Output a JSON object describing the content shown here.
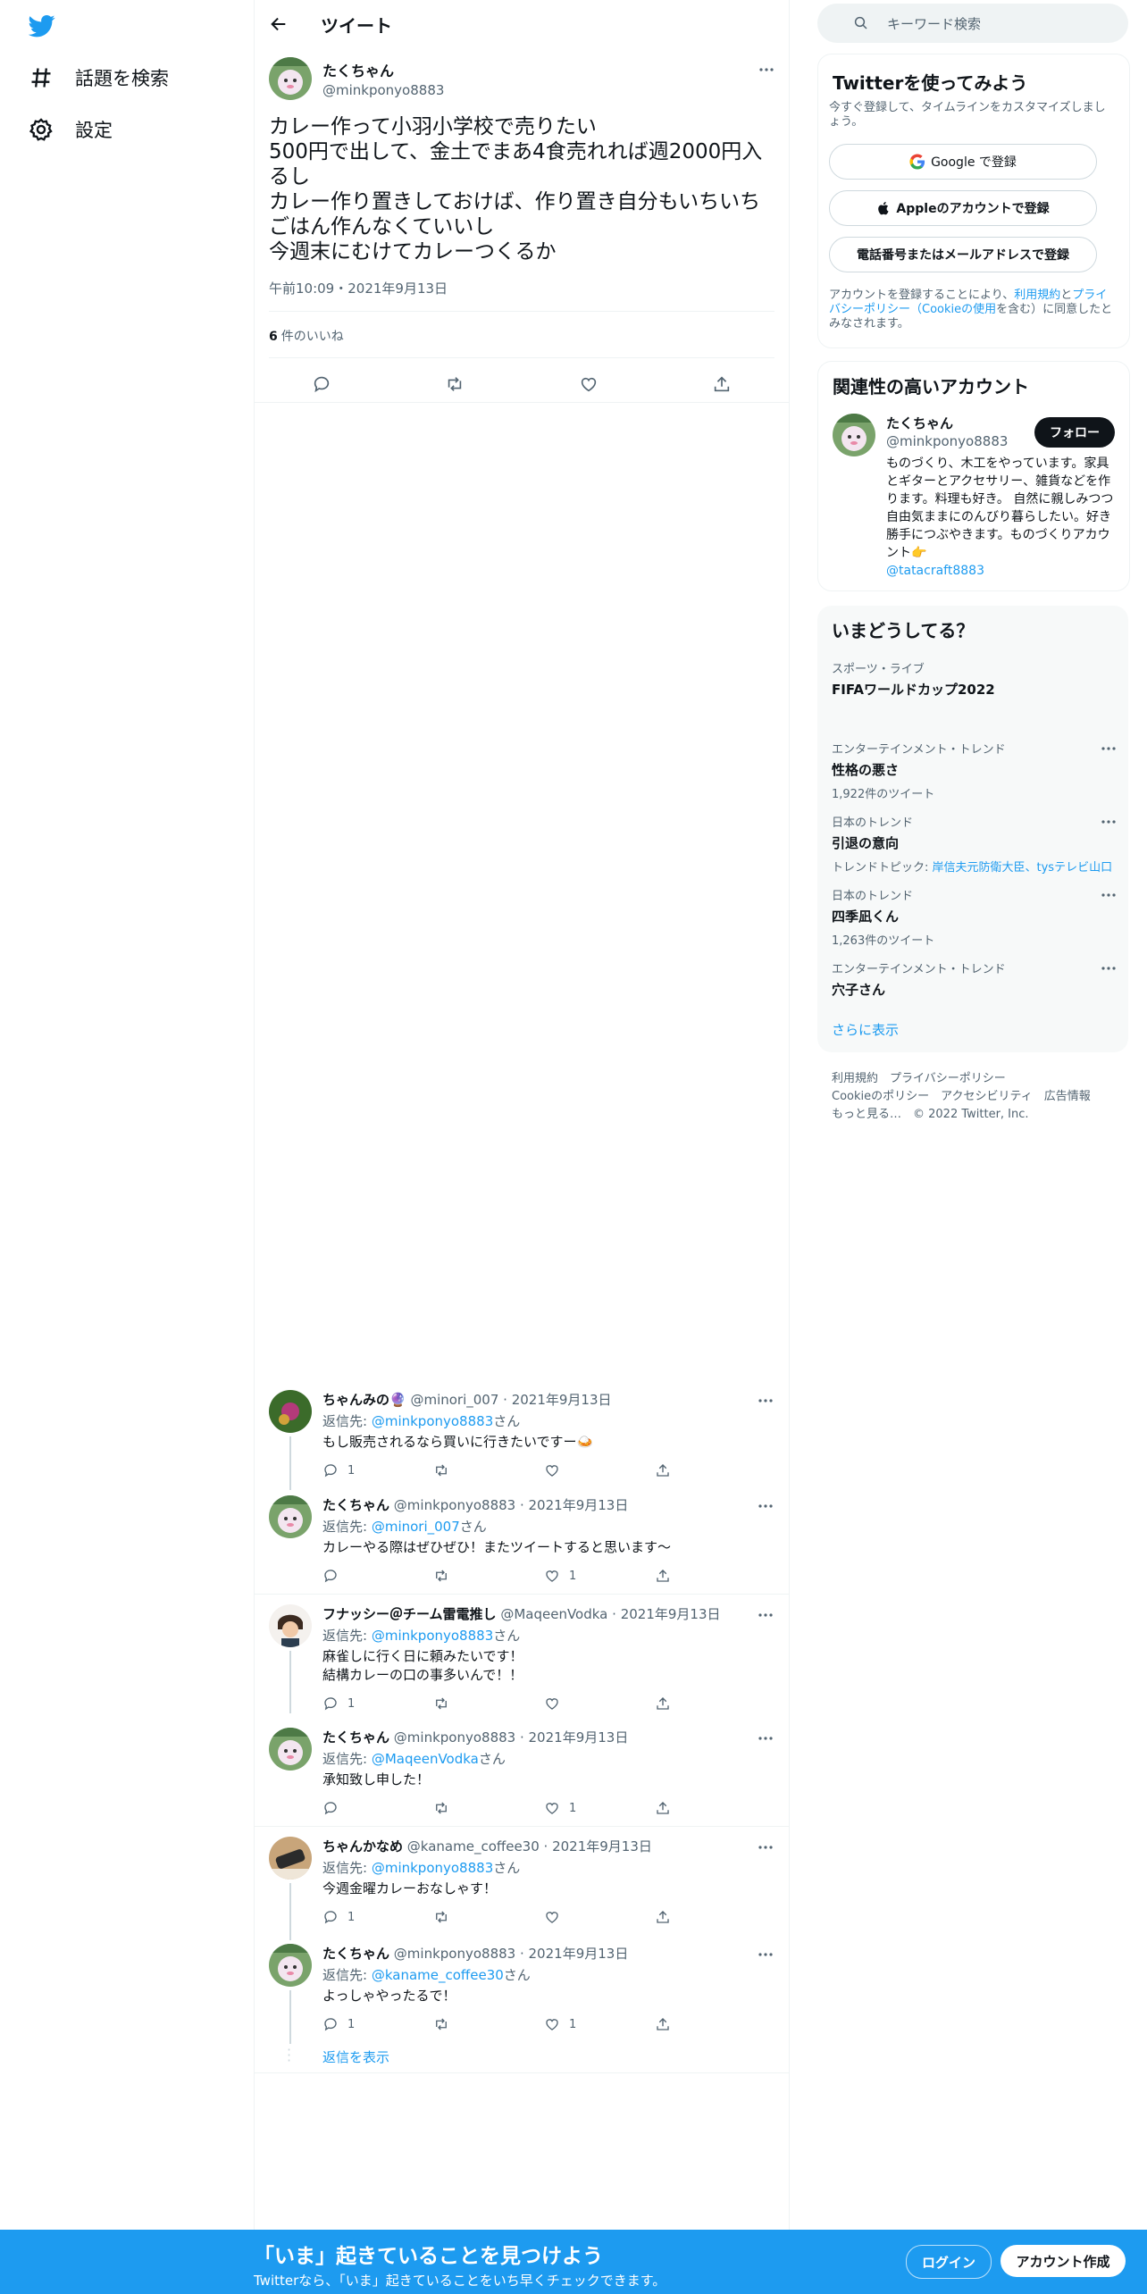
{
  "nav": {
    "explore": "話題を検索",
    "settings": "設定"
  },
  "header": {
    "title": "ツイート"
  },
  "main_tweet": {
    "name": "たくちゃん",
    "handle": "@minkponyo8883",
    "text": "カレー作って小羽小学校で売りたい\n500円で出して、金土でまあ4食売れれば週2000円入るし\nカレー作り置きしておけば、作り置き自分もいちいちごはん作んなくていいし\n今週末にむけてカレーつくるか",
    "time": "午前10:09・2021年9月13日",
    "likes_count": "6",
    "likes_label": "件のいいね"
  },
  "replies": [
    {
      "name": "ちゃんみの🔮",
      "handle": "@minori_007",
      "date": "2021年9月13日",
      "to_label": "返信先: ",
      "to_handle": "@minkponyo8883",
      "to_suffix": "さん",
      "text": "もし販売されるなら買いに行きたいですー🍛",
      "reply_count": "1",
      "retweet_count": "",
      "like_count": ""
    },
    {
      "name": "たくちゃん",
      "handle": "@minkponyo8883",
      "date": "2021年9月13日",
      "to_label": "返信先: ",
      "to_handle": "@minori_007",
      "to_suffix": "さん",
      "text": "カレーやる際はぜひぜひ！またツイートすると思います〜",
      "reply_count": "",
      "retweet_count": "",
      "like_count": "1"
    },
    {
      "name": "フナッシー＠チーム雷電推し",
      "handle": "@MaqeenVodka",
      "date": "2021年9月13日",
      "to_label": "返信先: ",
      "to_handle": "@minkponyo8883",
      "to_suffix": "さん",
      "text": "麻雀しに行く日に頼みたいです！\n結構カレーの口の事多いんで！！",
      "reply_count": "1",
      "retweet_count": "",
      "like_count": ""
    },
    {
      "name": "たくちゃん",
      "handle": "@minkponyo8883",
      "date": "2021年9月13日",
      "to_label": "返信先: ",
      "to_handle": "@MaqeenVodka",
      "to_suffix": "さん",
      "text": "承知致し申した！",
      "reply_count": "",
      "retweet_count": "",
      "like_count": "1"
    },
    {
      "name": "ちゃんかなめ",
      "handle": "@kaname_coffee30",
      "date": "2021年9月13日",
      "to_label": "返信先: ",
      "to_handle": "@minkponyo8883",
      "to_suffix": "さん",
      "text": "今週金曜カレーおなしゃす！",
      "reply_count": "1",
      "retweet_count": "",
      "like_count": ""
    },
    {
      "name": "たくちゃん",
      "handle": "@minkponyo8883",
      "date": "2021年9月13日",
      "to_label": "返信先: ",
      "to_handle": "@kaname_coffee30",
      "to_suffix": "さん",
      "text": "よっしゃやったるで！",
      "reply_count": "1",
      "retweet_count": "",
      "like_count": "1"
    }
  ],
  "show_replies": "返信を表示",
  "search": {
    "placeholder": "キーワード検索"
  },
  "signup_card": {
    "title": "Twitterを使ってみよう",
    "subtitle": "今すぐ登録して、タイムラインをカスタマイズしましょう。",
    "google": "Google で登録",
    "apple": "Appleのアカウントで登録",
    "phone": "電話番号またはメールアドレスで登録",
    "legal_prefix": "アカウントを登録することにより、",
    "legal_terms": "利用規約",
    "legal_and": "と",
    "legal_privacy": "プライバシーポリシー（Cookieの使用",
    "legal_suffix": "を含む）に同意したとみなされます。"
  },
  "related": {
    "title": "関連性の高いアカウント",
    "name": "たくちゃん",
    "handle": "@minkponyo8883",
    "follow": "フォロー",
    "bio": "ものづくり、木工をやっています。家具とギターとアクセサリー、雑貨などを作ります。料理も好き。 自然に親しみつつ自由気ままにのんびり暮らしたい。好き勝手につぶやきます。ものづくりアカウント👉",
    "bio_link": "@tatacraft8883"
  },
  "trends": {
    "title": "いまどうしてる？",
    "items": [
      {
        "category": "スポーツ・ライブ",
        "name": "FIFAワールドカップ2022",
        "sub": ""
      },
      {
        "category": "エンターテインメント・トレンド",
        "name": "性格の悪さ",
        "sub": "1,922件のツイート"
      },
      {
        "category": "日本のトレンド",
        "name": "引退の意向",
        "sub_label": "トレンドトピック: ",
        "sub_link": "岸信夫元防衛大臣、tysテレビ山口"
      },
      {
        "category": "日本のトレンド",
        "name": "四季凪くん",
        "sub": "1,263件のツイート"
      },
      {
        "category": "エンターテインメント・トレンド",
        "name": "穴子さん",
        "sub": ""
      }
    ],
    "show_more": "さらに表示"
  },
  "footer": {
    "line1": "利用規約　プライバシーポリシー",
    "line2": "Cookieのポリシー　アクセシビリティ　広告情報",
    "line3": "もっと見る…　© 2022 Twitter, Inc."
  },
  "bottom_bar": {
    "headline": "「いま」起きていることを見つけよう",
    "subline": "Twitterなら、「いま」起きていることをいち早くチェックできます。",
    "login": "ログイン",
    "signup": "アカウント作成"
  },
  "colors": {
    "accent": "#1d9bf0",
    "text": "#0f1419",
    "muted": "#536471"
  }
}
